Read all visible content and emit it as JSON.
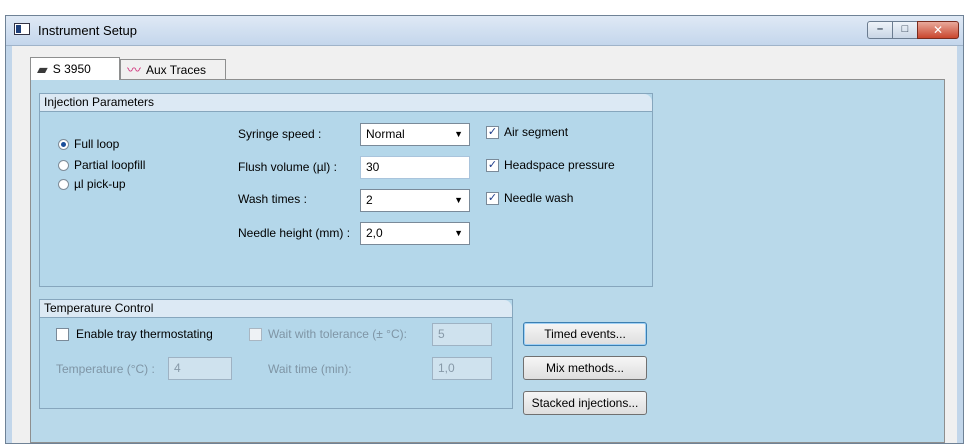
{
  "window": {
    "title": "Instrument Setup",
    "caption_buttons": {
      "minimize": "–",
      "maximize": "□",
      "close": "✕"
    }
  },
  "tabs": [
    {
      "label": "S 3950",
      "icon": "instrument-icon",
      "active": true
    },
    {
      "label": "Aux Traces",
      "icon": "traces-icon",
      "active": false
    }
  ],
  "injection": {
    "header": "Injection Parameters",
    "modes": [
      {
        "label": "Full loop",
        "checked": true
      },
      {
        "label": "Partial loopfill",
        "checked": false
      },
      {
        "label": "µl pick-up",
        "checked": false
      }
    ],
    "syringe_speed": {
      "label": "Syringe speed :",
      "value": "Normal"
    },
    "flush_volume": {
      "label": "Flush volume (µl) :",
      "value": "30"
    },
    "wash_times": {
      "label": "Wash times :",
      "value": "2"
    },
    "needle_height": {
      "label": "Needle height (mm) :",
      "value": "2,0"
    },
    "options": [
      {
        "label": "Air segment",
        "checked": true
      },
      {
        "label": "Headspace pressure",
        "checked": true
      },
      {
        "label": "Needle wash",
        "checked": true
      }
    ]
  },
  "temperature": {
    "header": "Temperature Control",
    "enable_tray": {
      "label": "Enable tray thermostating",
      "checked": false
    },
    "wait_tolerance": {
      "label": "Wait with tolerance (± °C):",
      "value": "5",
      "checked": false
    },
    "temperature": {
      "label": "Temperature (°C) :",
      "value": "4"
    },
    "wait_time": {
      "label": "Wait time (min):",
      "value": "1,0"
    }
  },
  "buttons": {
    "timed_events": "Timed events...",
    "mix_methods": "Mix methods...",
    "stacked_injections": "Stacked injections..."
  }
}
